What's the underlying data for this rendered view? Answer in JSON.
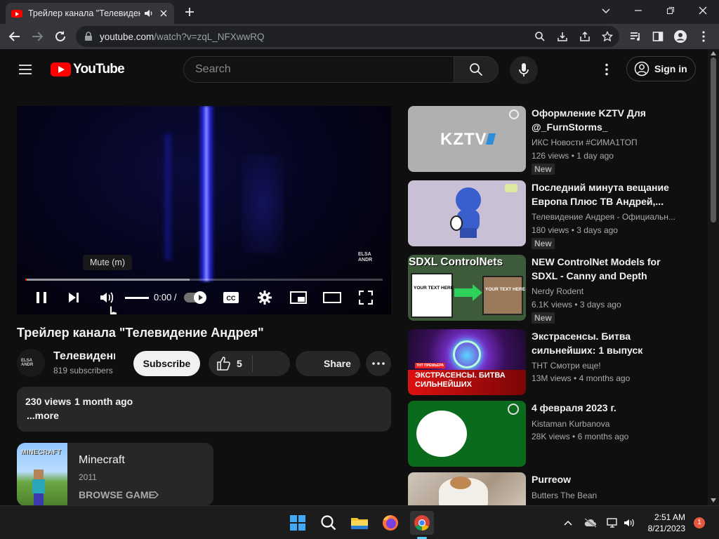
{
  "browser": {
    "tab_title": "Трейлер канала \"Телевидение Андрея\"",
    "url_host": "youtube.com",
    "url_path": "/watch?v=zqL_NFXwwRQ"
  },
  "header": {
    "logo_text": "YouTube",
    "search_placeholder": "Search",
    "signin_label": "Sign in"
  },
  "player": {
    "tooltip": "Mute (m)",
    "time": "0:00 /",
    "progress_played": 0.0,
    "progress_buffered": 0.46,
    "watermark": "ELSA ANDR"
  },
  "video": {
    "title": "Трейлер канала \"Телевидение Андрея\"",
    "channel_name": "Телевидение Андрея",
    "subscribers": "819 subscribers",
    "subscribe_label": "Subscribe",
    "likes": "5",
    "share_label": "Share",
    "views": "230 views",
    "date": "1 month ago",
    "more_label": "...more"
  },
  "game": {
    "title": "Minecraft",
    "year": "2011",
    "browse_label": "BROWSE GAME",
    "thumb_text": "MINECRAFT"
  },
  "recommendations": [
    {
      "title": "Оформление KZTV Для @_FurnStorms_",
      "channel": "ИКС Новости #СИМА1ТОП",
      "views": "126 views",
      "age": "1 day ago",
      "badge": "New",
      "thumb_text": "KZTV"
    },
    {
      "title": "Последний минута вещание Европа Плюс ТВ Андрей,...",
      "channel": "Телевидение Андрея - Официальн...",
      "views": "180 views",
      "age": "3 days ago",
      "badge": "New",
      "thumb_text": ""
    },
    {
      "title": "NEW ControlNet Models for SDXL - Canny and Depth",
      "channel": "Nerdy Rodent",
      "views": "6.1K views",
      "age": "3 days ago",
      "badge": "New",
      "thumb_text": "SDXL ControlNets",
      "thumb_sub1": "YOUR TEXT HERE",
      "thumb_sub2": "YOUR TEXT HERE"
    },
    {
      "title": "Экстрасенсы. Битва сильнейших: 1 выпуск",
      "channel": "ТНТ Смотри еще!",
      "views": "13M views",
      "age": "4 months ago",
      "badge": "",
      "thumb_text": "ЭКСТРАСЕНСЫ. БИТВА СИЛЬНЕЙШИХ",
      "thumb_sub1": "ТНТ ПРЕМЬЕРА"
    },
    {
      "title": "4 февраля 2023 г.",
      "channel": "Kistaman Kurbanova",
      "views": "28K views",
      "age": "6 months ago",
      "badge": "",
      "thumb_text": ""
    },
    {
      "title": "Purreow",
      "channel": "Butters The Bean",
      "views": "",
      "age": "",
      "badge": "",
      "thumb_text": ""
    }
  ],
  "taskbar": {
    "time": "2:51 AM",
    "date": "8/21/2023",
    "notification_count": "1"
  }
}
